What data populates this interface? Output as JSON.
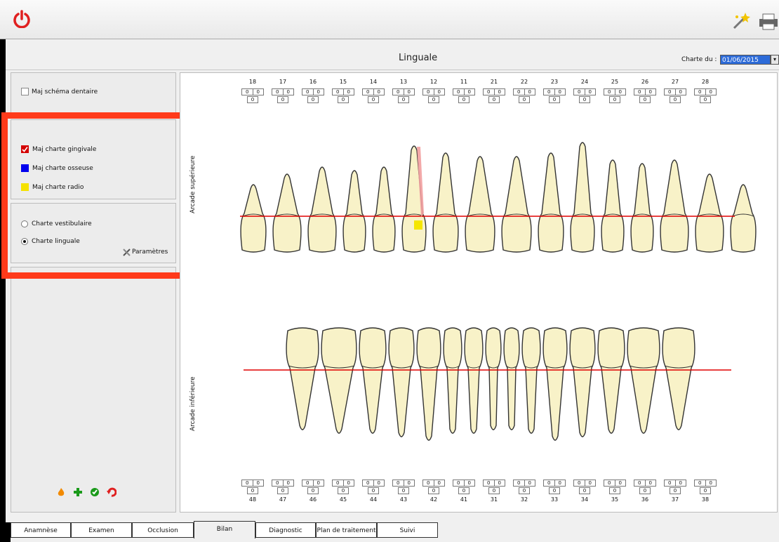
{
  "header": {
    "title": "Linguale",
    "charte_label": "Charte du :",
    "date_value": "01/06/2015"
  },
  "sidebar": {
    "maj_schema": "Maj schéma dentaire",
    "charts": [
      {
        "label": "Maj charte gingivale",
        "color": "#d40000",
        "checked": true
      },
      {
        "label": "Maj charte osseuse",
        "color": "#0000ee"
      },
      {
        "label": "Maj charte radio",
        "color": "#f5e100"
      }
    ],
    "radio": [
      {
        "label": "Charte vestibulaire",
        "selected": false
      },
      {
        "label": "Charte linguale",
        "selected": true
      }
    ],
    "params_label": "Paramètres"
  },
  "upper_teeth": [
    "18",
    "17",
    "16",
    "15",
    "14",
    "13",
    "12",
    "11",
    "21",
    "22",
    "23",
    "24",
    "25",
    "26",
    "27",
    "28"
  ],
  "lower_teeth": [
    "48",
    "47",
    "46",
    "45",
    "44",
    "43",
    "42",
    "41",
    "31",
    "32",
    "33",
    "34",
    "35",
    "36",
    "37",
    "38"
  ],
  "measure_value": "0",
  "arcade": {
    "upper": "Arcade supérieure",
    "lower": "Arcade inférieure"
  },
  "tabs": [
    "Anamnèse",
    "Examen",
    "Occlusion",
    "Bilan",
    "Diagnostic",
    "Plan de traitement",
    "Suivi"
  ],
  "active_tab": "Bilan"
}
